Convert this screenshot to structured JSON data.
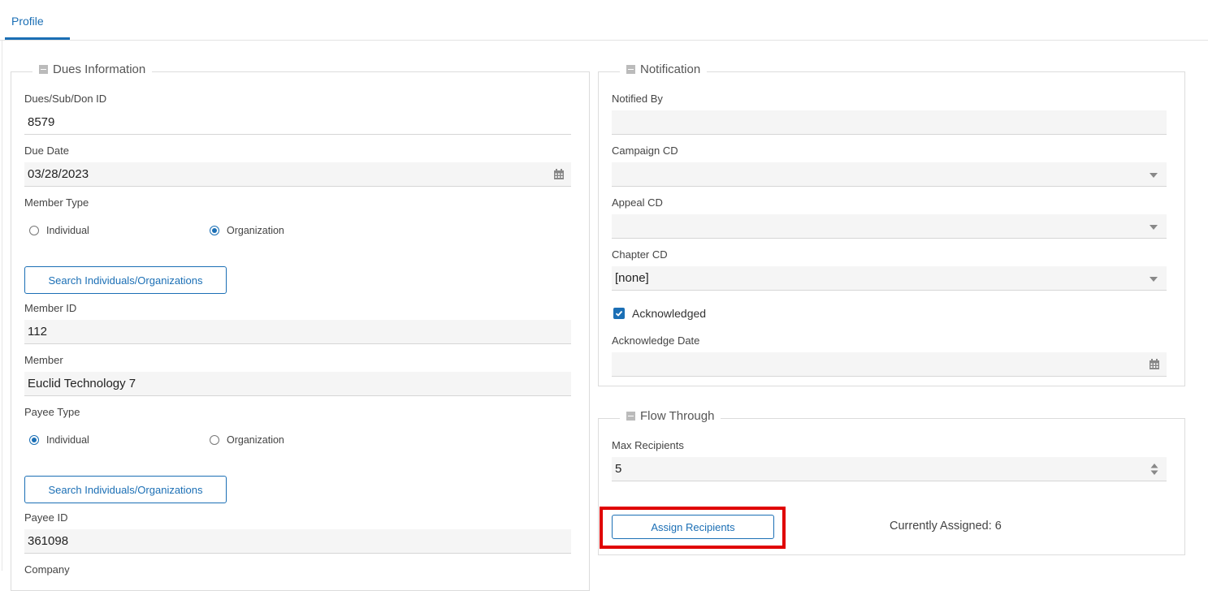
{
  "tabs": [
    {
      "label": "Profile"
    }
  ],
  "dues": {
    "legend": "Dues Information",
    "id_label": "Dues/Sub/Don ID",
    "id_value": "8579",
    "due_date_label": "Due Date",
    "due_date_value": "03/28/2023",
    "member_type_label": "Member Type",
    "member_type_options": [
      "Individual",
      "Organization"
    ],
    "member_type_selected": "Organization",
    "search_button_1": "Search Individuals/Organizations",
    "member_id_label": "Member ID",
    "member_id_value": "112",
    "member_label": "Member",
    "member_value": "Euclid Technology 7",
    "payee_type_label": "Payee Type",
    "payee_type_options": [
      "Individual",
      "Organization"
    ],
    "payee_type_selected": "Individual",
    "search_button_2": "Search Individuals/Organizations",
    "payee_id_label": "Payee ID",
    "payee_id_value": "361098",
    "company_label": "Company"
  },
  "notification": {
    "legend": "Notification",
    "notified_by_label": "Notified By",
    "notified_by_value": "",
    "campaign_label": "Campaign CD",
    "campaign_value": "",
    "appeal_label": "Appeal CD",
    "appeal_value": "",
    "chapter_label": "Chapter CD",
    "chapter_value": "[none]",
    "acknowledged_label": "Acknowledged",
    "acknowledged_checked": true,
    "ack_date_label": "Acknowledge Date",
    "ack_date_value": ""
  },
  "flow": {
    "legend": "Flow Through",
    "max_label": "Max Recipients",
    "max_value": "5",
    "assign_button": "Assign Recipients",
    "assigned_text": "Currently Assigned: 6"
  },
  "colors": {
    "accent": "#1b6fb5",
    "highlight": "#e00000"
  },
  "icons": [
    "calendar-icon",
    "chevron-down-icon",
    "spinner-icon",
    "checkmark-icon",
    "collapse-icon"
  ]
}
